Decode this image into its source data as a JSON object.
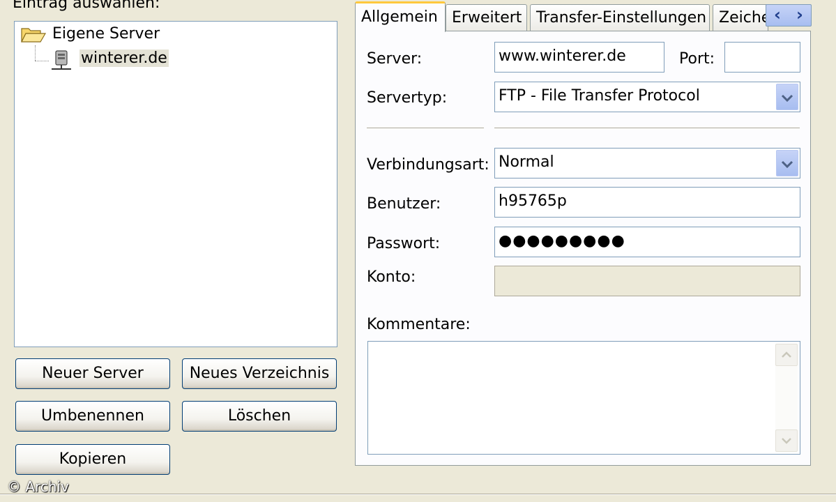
{
  "left": {
    "header_label": "Eintrag auswählen:",
    "tree": {
      "root_label": "Eigene Server",
      "child_label": "winterer.de"
    },
    "buttons": {
      "new_server": "Neuer Server",
      "new_folder": "Neues Verzeichnis",
      "rename": "Umbenennen",
      "delete": "Löschen",
      "copy": "Kopieren"
    }
  },
  "tabs": {
    "items": [
      "Allgemein",
      "Erweitert",
      "Transfer-Einstellungen",
      "Zeiche"
    ],
    "active": "Allgemein",
    "scroll_left": "‹",
    "scroll_right": "›"
  },
  "form": {
    "server_label": "Server:",
    "server_value": "www.winterer.de",
    "port_label": "Port:",
    "port_value": "",
    "servertype_label": "Servertyp:",
    "servertype_value": "FTP - File Transfer Protocol",
    "connection_label": "Verbindungsart:",
    "connection_value": "Normal",
    "user_label": "Benutzer:",
    "user_value": "h95765p",
    "password_label": "Passwort:",
    "password_value": "●●●●●●●●●",
    "account_label": "Konto:",
    "account_value": "",
    "comments_label": "Kommentare:",
    "comments_value": ""
  },
  "watermark": "© Archiv",
  "colors": {
    "window_bg": "#ece9d8",
    "field_border": "#7f9db9",
    "active_tab_accent": "#ffc83c",
    "dropdown_button": "#b9c8f1"
  },
  "icons": {
    "folder": "folder-open-icon",
    "server": "server-icon",
    "dropdown": "chevron-down-icon"
  }
}
